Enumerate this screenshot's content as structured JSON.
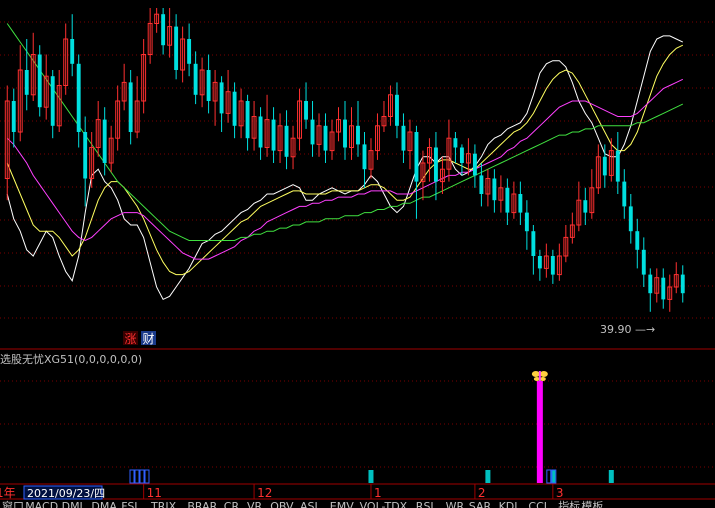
{
  "chart_data": {
    "type": "candlestick",
    "main_panel": {
      "min_price_label": "39.90",
      "min_price_arrow": "—→",
      "badges": [
        {
          "text": "涨",
          "color": "#ff3030",
          "bg": "#3a0000"
        },
        {
          "text": "财",
          "color": "#ffffff",
          "bg": "#1a3a8a"
        }
      ],
      "candles": [
        [
          0.55,
          0.3,
          0.62,
          0.25
        ],
        [
          0.3,
          0.4,
          0.45,
          0.26
        ],
        [
          0.4,
          0.2,
          0.43,
          0.12
        ],
        [
          0.2,
          0.28,
          0.33,
          0.1
        ],
        [
          0.28,
          0.15,
          0.3,
          0.08
        ],
        [
          0.15,
          0.32,
          0.35,
          0.12
        ],
        [
          0.32,
          0.22,
          0.36,
          0.15
        ],
        [
          0.22,
          0.38,
          0.42,
          0.2
        ],
        [
          0.38,
          0.25,
          0.4,
          0.2
        ],
        [
          0.25,
          0.1,
          0.28,
          0.05
        ],
        [
          0.1,
          0.18,
          0.22,
          0.02
        ],
        [
          0.18,
          0.4,
          0.45,
          0.15
        ],
        [
          0.4,
          0.55,
          0.64,
          0.35
        ],
        [
          0.55,
          0.45,
          0.58,
          0.4
        ],
        [
          0.45,
          0.36,
          0.48,
          0.3
        ],
        [
          0.36,
          0.5,
          0.54,
          0.32
        ],
        [
          0.5,
          0.42,
          0.53,
          0.38
        ],
        [
          0.42,
          0.3,
          0.46,
          0.25
        ],
        [
          0.3,
          0.24,
          0.33,
          0.18
        ],
        [
          0.24,
          0.4,
          0.44,
          0.2
        ],
        [
          0.4,
          0.3,
          0.42,
          0.22
        ],
        [
          0.3,
          0.15,
          0.34,
          0.1
        ],
        [
          0.15,
          0.05,
          0.18,
          0.0
        ],
        [
          0.05,
          0.02,
          0.08,
          0.0
        ],
        [
          0.02,
          0.12,
          0.15,
          0.0
        ],
        [
          0.12,
          0.06,
          0.16,
          0.0
        ],
        [
          0.06,
          0.2,
          0.23,
          0.02
        ],
        [
          0.2,
          0.1,
          0.24,
          0.06
        ],
        [
          0.1,
          0.18,
          0.22,
          0.05
        ],
        [
          0.18,
          0.28,
          0.31,
          0.14
        ],
        [
          0.28,
          0.2,
          0.32,
          0.16
        ],
        [
          0.2,
          0.3,
          0.34,
          0.15
        ],
        [
          0.3,
          0.24,
          0.38,
          0.2
        ],
        [
          0.24,
          0.34,
          0.4,
          0.22
        ],
        [
          0.34,
          0.27,
          0.37,
          0.2
        ],
        [
          0.27,
          0.38,
          0.42,
          0.24
        ],
        [
          0.38,
          0.3,
          0.42,
          0.26
        ],
        [
          0.3,
          0.42,
          0.46,
          0.28
        ],
        [
          0.42,
          0.35,
          0.46,
          0.3
        ],
        [
          0.35,
          0.45,
          0.49,
          0.32
        ],
        [
          0.45,
          0.36,
          0.48,
          0.28
        ],
        [
          0.36,
          0.46,
          0.5,
          0.32
        ],
        [
          0.46,
          0.38,
          0.5,
          0.34
        ],
        [
          0.38,
          0.48,
          0.52,
          0.33
        ],
        [
          0.48,
          0.42,
          0.52,
          0.38
        ],
        [
          0.42,
          0.3,
          0.46,
          0.26
        ],
        [
          0.3,
          0.36,
          0.39,
          0.24
        ],
        [
          0.36,
          0.44,
          0.48,
          0.3
        ],
        [
          0.44,
          0.38,
          0.48,
          0.34
        ],
        [
          0.38,
          0.46,
          0.5,
          0.34
        ],
        [
          0.46,
          0.4,
          0.49,
          0.36
        ],
        [
          0.4,
          0.36,
          0.43,
          0.32
        ],
        [
          0.36,
          0.45,
          0.49,
          0.3
        ],
        [
          0.45,
          0.38,
          0.49,
          0.32
        ],
        [
          0.38,
          0.44,
          0.48,
          0.3
        ],
        [
          0.44,
          0.52,
          0.58,
          0.4
        ],
        [
          0.52,
          0.46,
          0.55,
          0.42
        ],
        [
          0.46,
          0.38,
          0.49,
          0.34
        ],
        [
          0.38,
          0.35,
          0.4,
          0.3
        ],
        [
          0.35,
          0.28,
          0.38,
          0.25
        ],
        [
          0.28,
          0.38,
          0.42,
          0.24
        ],
        [
          0.38,
          0.46,
          0.5,
          0.34
        ],
        [
          0.46,
          0.4,
          0.52,
          0.36
        ],
        [
          0.4,
          0.56,
          0.68,
          0.38
        ],
        [
          0.56,
          0.5,
          0.62,
          0.46
        ],
        [
          0.5,
          0.45,
          0.56,
          0.42
        ],
        [
          0.45,
          0.56,
          0.62,
          0.4
        ],
        [
          0.56,
          0.52,
          0.6,
          0.48
        ],
        [
          0.52,
          0.42,
          0.56,
          0.36
        ],
        [
          0.42,
          0.45,
          0.5,
          0.4
        ],
        [
          0.45,
          0.5,
          0.54,
          0.44
        ],
        [
          0.5,
          0.47,
          0.54,
          0.42
        ],
        [
          0.47,
          0.54,
          0.58,
          0.44
        ],
        [
          0.54,
          0.6,
          0.64,
          0.5
        ],
        [
          0.6,
          0.55,
          0.64,
          0.52
        ],
        [
          0.55,
          0.62,
          0.66,
          0.52
        ],
        [
          0.62,
          0.58,
          0.66,
          0.54
        ],
        [
          0.58,
          0.66,
          0.7,
          0.55
        ],
        [
          0.66,
          0.6,
          0.68,
          0.56
        ],
        [
          0.6,
          0.66,
          0.7,
          0.56
        ],
        [
          0.66,
          0.72,
          0.78,
          0.62
        ],
        [
          0.72,
          0.8,
          0.86,
          0.7
        ],
        [
          0.8,
          0.84,
          0.88,
          0.78
        ],
        [
          0.84,
          0.8,
          0.87,
          0.76
        ],
        [
          0.8,
          0.86,
          0.89,
          0.78
        ],
        [
          0.86,
          0.8,
          0.88,
          0.76
        ],
        [
          0.8,
          0.74,
          0.82,
          0.7
        ],
        [
          0.74,
          0.7,
          0.76,
          0.66
        ],
        [
          0.7,
          0.62,
          0.72,
          0.56
        ],
        [
          0.62,
          0.66,
          0.7,
          0.58
        ],
        [
          0.66,
          0.58,
          0.68,
          0.52
        ],
        [
          0.58,
          0.48,
          0.6,
          0.44
        ],
        [
          0.48,
          0.54,
          0.58,
          0.44
        ],
        [
          0.54,
          0.46,
          0.56,
          0.42
        ],
        [
          0.46,
          0.56,
          0.6,
          0.4
        ],
        [
          0.56,
          0.64,
          0.68,
          0.52
        ],
        [
          0.64,
          0.72,
          0.76,
          0.6
        ],
        [
          0.72,
          0.78,
          0.84,
          0.68
        ],
        [
          0.78,
          0.86,
          0.9,
          0.74
        ],
        [
          0.86,
          0.92,
          0.98,
          0.84
        ],
        [
          0.92,
          0.87,
          0.95,
          0.84
        ],
        [
          0.87,
          0.94,
          0.97,
          0.84
        ],
        [
          0.94,
          0.9,
          0.98,
          0.86
        ],
        [
          0.9,
          0.86,
          0.92,
          0.82
        ],
        [
          0.86,
          0.92,
          0.95,
          0.83
        ]
      ],
      "ma_lines": [
        {
          "color": "#ffffff",
          "values": [
            0.4,
            0.32,
            0.28,
            0.22,
            0.2,
            0.24,
            0.28,
            0.26,
            0.2,
            0.15,
            0.12,
            0.2,
            0.34,
            0.46,
            0.48,
            0.44,
            0.42,
            0.38,
            0.32,
            0.3,
            0.3,
            0.26,
            0.18,
            0.1,
            0.06,
            0.07,
            0.1,
            0.13,
            0.16,
            0.2,
            0.24,
            0.25,
            0.27,
            0.28,
            0.3,
            0.32,
            0.34,
            0.35,
            0.37,
            0.38,
            0.4,
            0.4,
            0.41,
            0.42,
            0.43,
            0.42,
            0.38,
            0.38,
            0.4,
            0.41,
            0.42,
            0.41,
            0.4,
            0.41,
            0.41,
            0.43,
            0.46,
            0.44,
            0.4,
            0.36,
            0.34,
            0.36,
            0.42,
            0.48,
            0.52,
            0.52,
            0.5,
            0.52,
            0.52,
            0.48,
            0.46,
            0.47,
            0.49,
            0.52,
            0.56,
            0.58,
            0.59,
            0.61,
            0.62,
            0.63,
            0.66,
            0.72,
            0.79,
            0.82,
            0.83,
            0.83,
            0.81,
            0.76,
            0.7,
            0.66,
            0.63,
            0.58,
            0.53,
            0.52,
            0.52,
            0.56,
            0.62,
            0.7,
            0.78,
            0.86,
            0.9,
            0.91,
            0.91,
            0.9,
            0.89
          ]
        },
        {
          "color": "#ffff60",
          "values": [
            0.5,
            0.45,
            0.4,
            0.35,
            0.3,
            0.28,
            0.28,
            0.28,
            0.26,
            0.23,
            0.2,
            0.22,
            0.26,
            0.32,
            0.38,
            0.42,
            0.44,
            0.44,
            0.42,
            0.39,
            0.36,
            0.32,
            0.27,
            0.22,
            0.18,
            0.15,
            0.14,
            0.14,
            0.15,
            0.17,
            0.19,
            0.21,
            0.23,
            0.25,
            0.27,
            0.29,
            0.31,
            0.32,
            0.34,
            0.36,
            0.37,
            0.38,
            0.39,
            0.4,
            0.41,
            0.41,
            0.4,
            0.4,
            0.4,
            0.4,
            0.41,
            0.41,
            0.41,
            0.41,
            0.41,
            0.42,
            0.43,
            0.43,
            0.42,
            0.4,
            0.38,
            0.38,
            0.39,
            0.42,
            0.45,
            0.48,
            0.5,
            0.51,
            0.51,
            0.5,
            0.49,
            0.48,
            0.48,
            0.5,
            0.52,
            0.54,
            0.56,
            0.58,
            0.6,
            0.61,
            0.63,
            0.66,
            0.7,
            0.74,
            0.77,
            0.79,
            0.8,
            0.79,
            0.76,
            0.72,
            0.68,
            0.64,
            0.6,
            0.56,
            0.54,
            0.54,
            0.56,
            0.6,
            0.66,
            0.72,
            0.78,
            0.82,
            0.85,
            0.87,
            0.88
          ]
        },
        {
          "color": "#ff40ff",
          "values": [
            0.58,
            0.56,
            0.53,
            0.5,
            0.46,
            0.43,
            0.4,
            0.37,
            0.34,
            0.31,
            0.28,
            0.26,
            0.25,
            0.26,
            0.28,
            0.3,
            0.32,
            0.33,
            0.34,
            0.34,
            0.34,
            0.33,
            0.31,
            0.29,
            0.27,
            0.25,
            0.23,
            0.21,
            0.2,
            0.19,
            0.19,
            0.19,
            0.2,
            0.21,
            0.22,
            0.23,
            0.25,
            0.26,
            0.28,
            0.29,
            0.31,
            0.32,
            0.33,
            0.34,
            0.35,
            0.36,
            0.36,
            0.37,
            0.37,
            0.38,
            0.38,
            0.39,
            0.39,
            0.39,
            0.4,
            0.4,
            0.41,
            0.41,
            0.41,
            0.41,
            0.4,
            0.4,
            0.4,
            0.41,
            0.42,
            0.43,
            0.44,
            0.45,
            0.46,
            0.46,
            0.47,
            0.47,
            0.48,
            0.49,
            0.5,
            0.51,
            0.52,
            0.54,
            0.55,
            0.57,
            0.58,
            0.6,
            0.62,
            0.64,
            0.66,
            0.68,
            0.69,
            0.7,
            0.7,
            0.7,
            0.69,
            0.68,
            0.67,
            0.66,
            0.65,
            0.65,
            0.65,
            0.66,
            0.68,
            0.7,
            0.72,
            0.74,
            0.75,
            0.76,
            0.77
          ]
        },
        {
          "color": "#40e040",
          "values": [
            0.95,
            0.92,
            0.89,
            0.86,
            0.83,
            0.8,
            0.77,
            0.74,
            0.71,
            0.68,
            0.65,
            0.62,
            0.59,
            0.56,
            0.53,
            0.5,
            0.47,
            0.44,
            0.42,
            0.4,
            0.38,
            0.36,
            0.34,
            0.32,
            0.3,
            0.28,
            0.27,
            0.26,
            0.25,
            0.25,
            0.25,
            0.25,
            0.25,
            0.25,
            0.25,
            0.25,
            0.26,
            0.26,
            0.27,
            0.27,
            0.28,
            0.28,
            0.29,
            0.29,
            0.3,
            0.3,
            0.31,
            0.31,
            0.31,
            0.32,
            0.32,
            0.32,
            0.33,
            0.33,
            0.33,
            0.34,
            0.34,
            0.35,
            0.35,
            0.36,
            0.36,
            0.37,
            0.37,
            0.38,
            0.39,
            0.39,
            0.4,
            0.41,
            0.42,
            0.43,
            0.44,
            0.45,
            0.46,
            0.47,
            0.48,
            0.49,
            0.5,
            0.51,
            0.52,
            0.53,
            0.54,
            0.55,
            0.56,
            0.57,
            0.58,
            0.59,
            0.59,
            0.6,
            0.6,
            0.61,
            0.61,
            0.62,
            0.62,
            0.62,
            0.62,
            0.62,
            0.62,
            0.63,
            0.63,
            0.64,
            0.65,
            0.66,
            0.67,
            0.68,
            0.69
          ]
        }
      ]
    },
    "indicator_panel": {
      "title": "选股无忧XG51(0,0,0,0,0,0)",
      "tall_bar_index": 82,
      "tall_bar_color": "#ff00ff",
      "marker_icon": "butterfly-icon",
      "marker_color": "#ffd040",
      "small_bar_indices": [
        56,
        74,
        84,
        93
      ],
      "small_bar_color": "#00c0c0",
      "hollow_blue_groups": [
        {
          "index": 18,
          "count": 4
        },
        {
          "index": 84,
          "count": 2
        }
      ]
    },
    "time_axis": {
      "left_partial": "1年",
      "selected_date": "2021/09/23/四",
      "month_ticks": [
        {
          "label": "11",
          "index": 21
        },
        {
          "label": "12",
          "index": 38
        },
        {
          "label": "1",
          "index": 56
        },
        {
          "label": "2",
          "index": 72
        },
        {
          "label": "3",
          "index": 84
        }
      ]
    },
    "bottom_tabs": [
      "窗口",
      "MACD",
      "DMI",
      "DMA",
      "FSL",
      "TRIX",
      "BRAR",
      "CR",
      "VR",
      "OBV",
      "ASI",
      "EMV",
      "VOL-TDX",
      "RSI",
      "WR",
      "SAR",
      "KDJ",
      "CCI",
      "指标",
      "模板"
    ],
    "colors": {
      "up": "#ff3030",
      "down": "#00e0e0",
      "grid": "#7a0000",
      "panel_border": "#a00000",
      "text": "#c0c0c0",
      "date_box_border": "#3060ff",
      "date_box_text": "#ffffff"
    }
  }
}
